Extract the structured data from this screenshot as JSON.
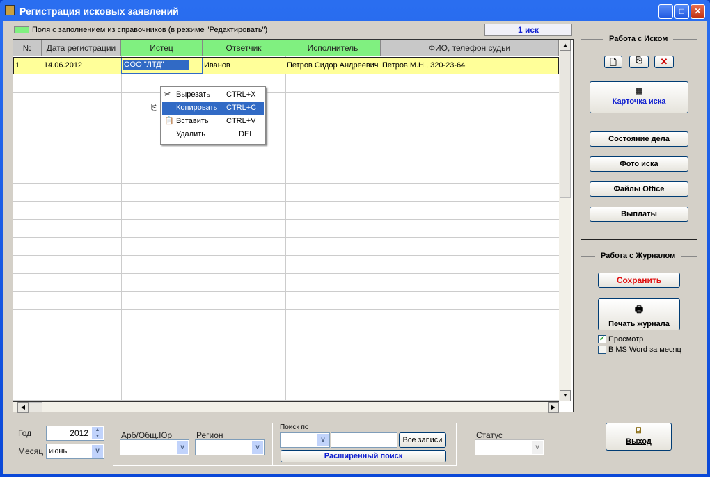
{
  "window": {
    "title": "Регистрация исковых заявлений",
    "minimize": "_",
    "maximize": "□",
    "close": "✕"
  },
  "legend": {
    "text": "Поля с заполнением из справочников (в режиме \"Редактировать\")",
    "color": "#80f080"
  },
  "count": "1 иск",
  "grid": {
    "columns": [
      "№",
      "Дата регистрации",
      "Истец",
      "Ответчик",
      "Исполнитель",
      "ФИО, телефон судьи"
    ],
    "rows": [
      {
        "num": "1",
        "date": "14.06.2012",
        "plaintiff": "ООО \"ЛТД\"",
        "defendant": "Иванов",
        "executor": "Петров Сидор Андреевич",
        "judge": "Петров М.Н., 320-23-64"
      }
    ]
  },
  "context_menu": [
    {
      "label": "Вырезать",
      "shortcut": "CTRL+X",
      "icon": "scissors-icon"
    },
    {
      "label": "Копировать",
      "shortcut": "CTRL+C",
      "icon": "copy-icon"
    },
    {
      "label": "Вставить",
      "shortcut": "CTRL+V",
      "icon": "paste-icon"
    },
    {
      "label": "Удалить",
      "shortcut": "DEL",
      "icon": ""
    }
  ],
  "claim_panel": {
    "title": "Работа с Иском",
    "card": "Карточка иска",
    "state": "Состояние дела",
    "photo": "Фото иска",
    "office": "Файлы Office",
    "payments": "Выплаты",
    "close_icon": "✕"
  },
  "journal_panel": {
    "title": "Работа с Журналом",
    "save": "Сохранить",
    "print": "Печать журнала",
    "preview": "Просмотр",
    "preview_checked": true,
    "word": "В MS Word за месяц",
    "word_checked": false
  },
  "filters": {
    "year_label": "Год",
    "year": "2012",
    "month_label": "Месяц",
    "month": "июнь",
    "arb_label": "Арб/Общ.Юр",
    "region_label": "Регион",
    "search_label": "Поиск по",
    "all_records": "Все записи",
    "extended_search": "Расширенный поиск",
    "status_label": "Статус"
  },
  "exit": "Выход"
}
